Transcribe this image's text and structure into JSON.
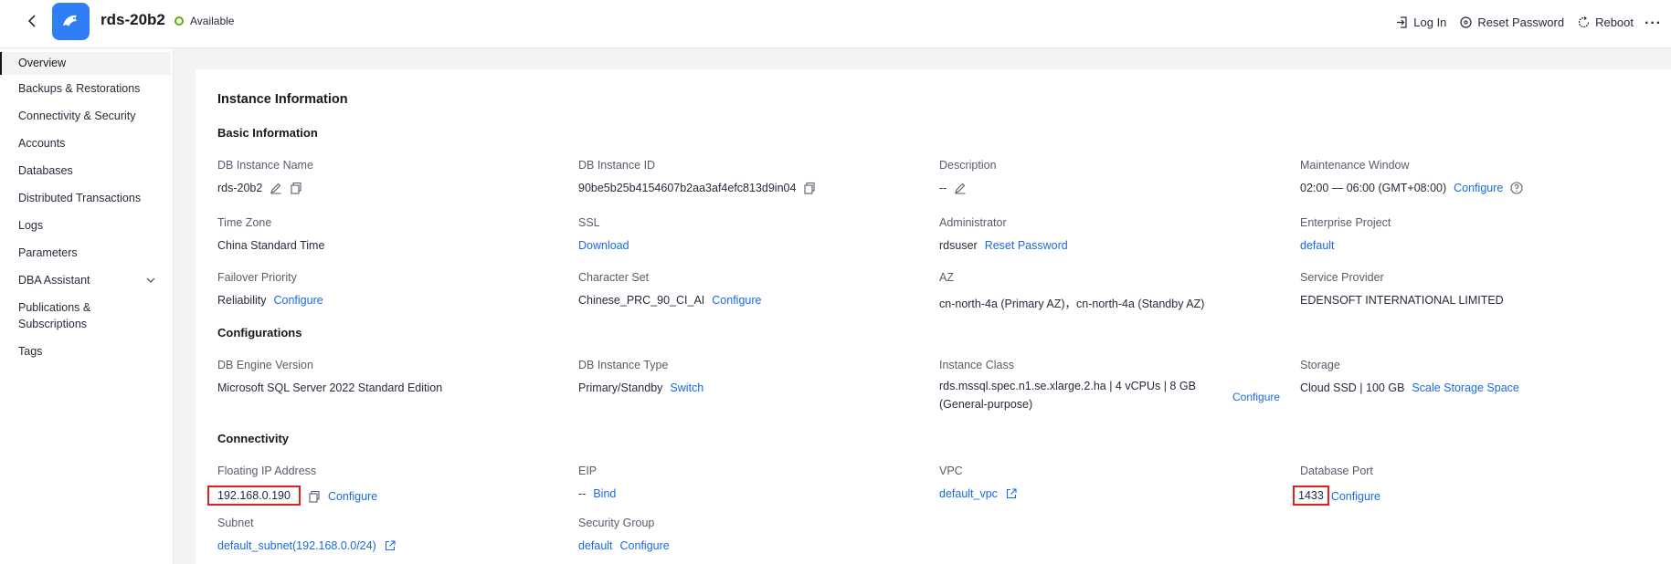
{
  "header": {
    "title": "rds-20b2",
    "status": "Available",
    "actions": [
      "Log In",
      "Reset Password",
      "Reboot"
    ],
    "more": "···"
  },
  "sidebar": {
    "items": [
      {
        "label": "Overview"
      },
      {
        "label": "Backups & Restorations"
      },
      {
        "label": "Connectivity & Security"
      },
      {
        "label": "Accounts"
      },
      {
        "label": "Databases"
      },
      {
        "label": "Distributed Transactions"
      },
      {
        "label": "Logs"
      },
      {
        "label": "Parameters"
      },
      {
        "label": "DBA Assistant"
      },
      {
        "label": "Publications & Subscriptions"
      },
      {
        "label": "Tags"
      }
    ]
  },
  "main": {
    "title": "Instance Information",
    "sections": {
      "basic": "Basic Information",
      "config": "Configurations",
      "conn": "Connectivity"
    },
    "basic": {
      "name_label": "DB Instance Name",
      "name_value": "rds-20b2",
      "id_label": "DB Instance ID",
      "id_value": "90be5b25b4154607b2aa3af4efc813d9in04",
      "desc_label": "Description",
      "desc_value": "--",
      "maint_label": "Maintenance Window",
      "maint_value": "02:00 — 06:00 (GMT+08:00)",
      "maint_link": "Configure",
      "tz_label": "Time Zone",
      "tz_value": "China Standard Time",
      "ssl_label": "SSL",
      "ssl_link": "Download",
      "admin_label": "Administrator",
      "admin_value": "rdsuser",
      "admin_link": "Reset Password",
      "ep_label": "Enterprise Project",
      "ep_link": "default",
      "fail_label": "Failover Priority",
      "fail_value": "Reliability",
      "fail_link": "Configure",
      "cs_label": "Character Set",
      "cs_value": "Chinese_PRC_90_CI_AI",
      "cs_link": "Configure",
      "az_label": "AZ",
      "az_value": "cn-north-4a (Primary AZ)，cn-north-4a (Standby AZ)",
      "sp_label": "Service Provider",
      "sp_value": "EDENSOFT INTERNATIONAL LIMITED"
    },
    "config": {
      "engine_label": "DB Engine Version",
      "engine_value": "Microsoft SQL Server 2022 Standard Edition",
      "type_label": "DB Instance Type",
      "type_value": "Primary/Standby",
      "type_link": "Switch",
      "class_label": "Instance Class",
      "class_value": "rds.mssql.spec.n1.se.xlarge.2.ha | 4 vCPUs | 8 GB (General-purpose)",
      "class_link": "Configure",
      "storage_label": "Storage",
      "storage_value": "Cloud SSD | 100 GB",
      "storage_link": "Scale Storage Space"
    },
    "conn": {
      "fip_label": "Floating IP Address",
      "fip_value": "192.168.0.190",
      "fip_link": "Configure",
      "eip_label": "EIP",
      "eip_value": "--",
      "eip_link": "Bind",
      "vpc_label": "VPC",
      "vpc_link": "default_vpc",
      "port_label": "Database Port",
      "port_value": "1433",
      "port_link": "Configure",
      "subnet_label": "Subnet",
      "subnet_link": "default_subnet(192.168.0.0/24)",
      "sg_label": "Security Group",
      "sg_link": "default",
      "sg_config": "Configure"
    }
  },
  "colors": {
    "accent": "#1a6ae0",
    "status_ok": "#5cb300",
    "highlight": "#e02020",
    "logo_bg": "#2f7ef5"
  }
}
